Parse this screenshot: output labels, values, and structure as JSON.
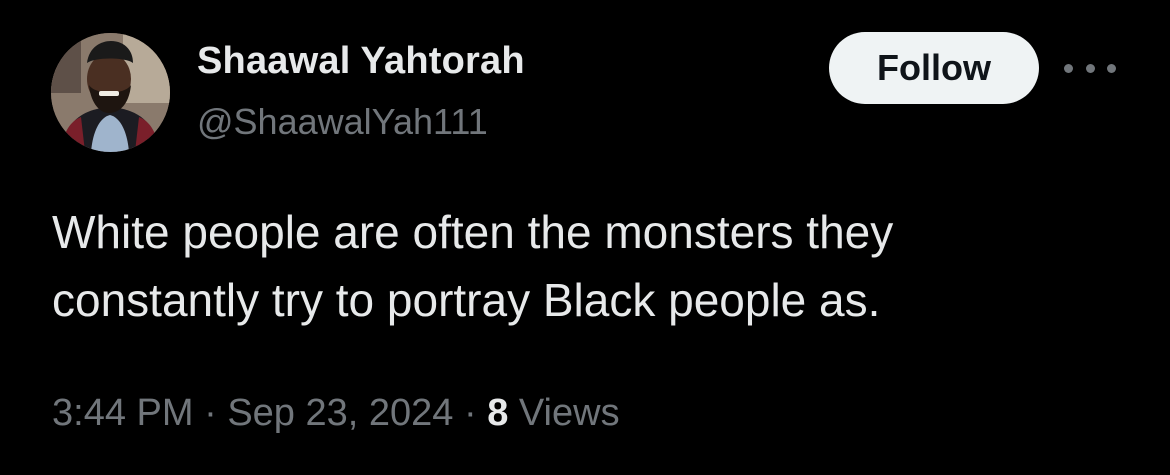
{
  "author": {
    "name": "Shaawal Yahtorah",
    "handle": "@ShaawalYah111"
  },
  "actions": {
    "follow_label": "Follow",
    "more_icon": "more-horizontal-icon"
  },
  "tweet": {
    "text_line1": "White people are often the monsters they",
    "text_line2": "constantly try to portray Black people as."
  },
  "meta": {
    "time": "3:44 PM",
    "separator": "·",
    "date": "Sep 23, 2024",
    "views_count": "8",
    "views_label": "Views"
  },
  "colors": {
    "background": "#000000",
    "primary_text": "#e7e9ea",
    "secondary_text": "#71767b",
    "follow_bg": "#eff3f4",
    "follow_text": "#0f1419"
  }
}
